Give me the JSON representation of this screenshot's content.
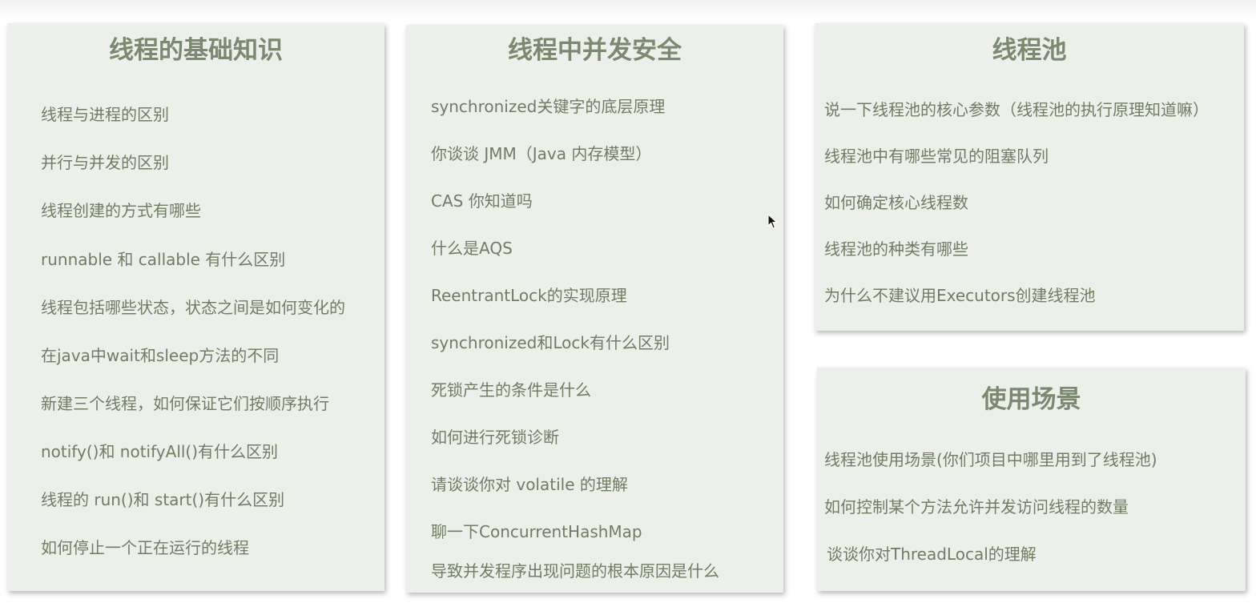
{
  "cards": {
    "basics": {
      "title": "线程的基础知识",
      "items": [
        "线程与进程的区别",
        "并行与并发的区别",
        "线程创建的方式有哪些",
        "runnable 和 callable 有什么区别",
        "线程包括哪些状态，状态之间是如何变化的",
        "在java中wait和sleep方法的不同",
        "新建三个线程，如何保证它们按顺序执行",
        "notify()和 notifyAll()有什么区别",
        "线程的 run()和 start()有什么区别",
        "如何停止一个正在运行的线程"
      ]
    },
    "concurrency": {
      "title": "线程中并发安全",
      "items": [
        "synchronized关键字的底层原理",
        "你谈谈 JMM（Java 内存模型）",
        "CAS 你知道吗",
        "什么是AQS",
        "ReentrantLock的实现原理",
        "synchronized和Lock有什么区别",
        "死锁产生的条件是什么",
        "如何进行死锁诊断",
        "请谈谈你对 volatile 的理解",
        "聊一下ConcurrentHashMap",
        "导致并发程序出现问题的根本原因是什么"
      ]
    },
    "pool": {
      "title": "线程池",
      "items": [
        "说一下线程池的核心参数（线程池的执行原理知道嘛）",
        "线程池中有哪些常见的阻塞队列",
        "如何确定核心线程数",
        "线程池的种类有哪些",
        "为什么不建议用Executors创建线程池"
      ]
    },
    "scenario": {
      "title": "使用场景",
      "items": [
        "线程池使用场景(你们项目中哪里用到了线程池)",
        "如何控制某个方法允许并发访问线程的数量",
        "谈谈你对ThreadLocal的理解"
      ]
    }
  },
  "colors": {
    "card_background": "#edefea",
    "title_text": "#7b8970",
    "item_text": "#6f7d63"
  },
  "icons": {
    "cursor": "mouse-pointer-icon"
  }
}
